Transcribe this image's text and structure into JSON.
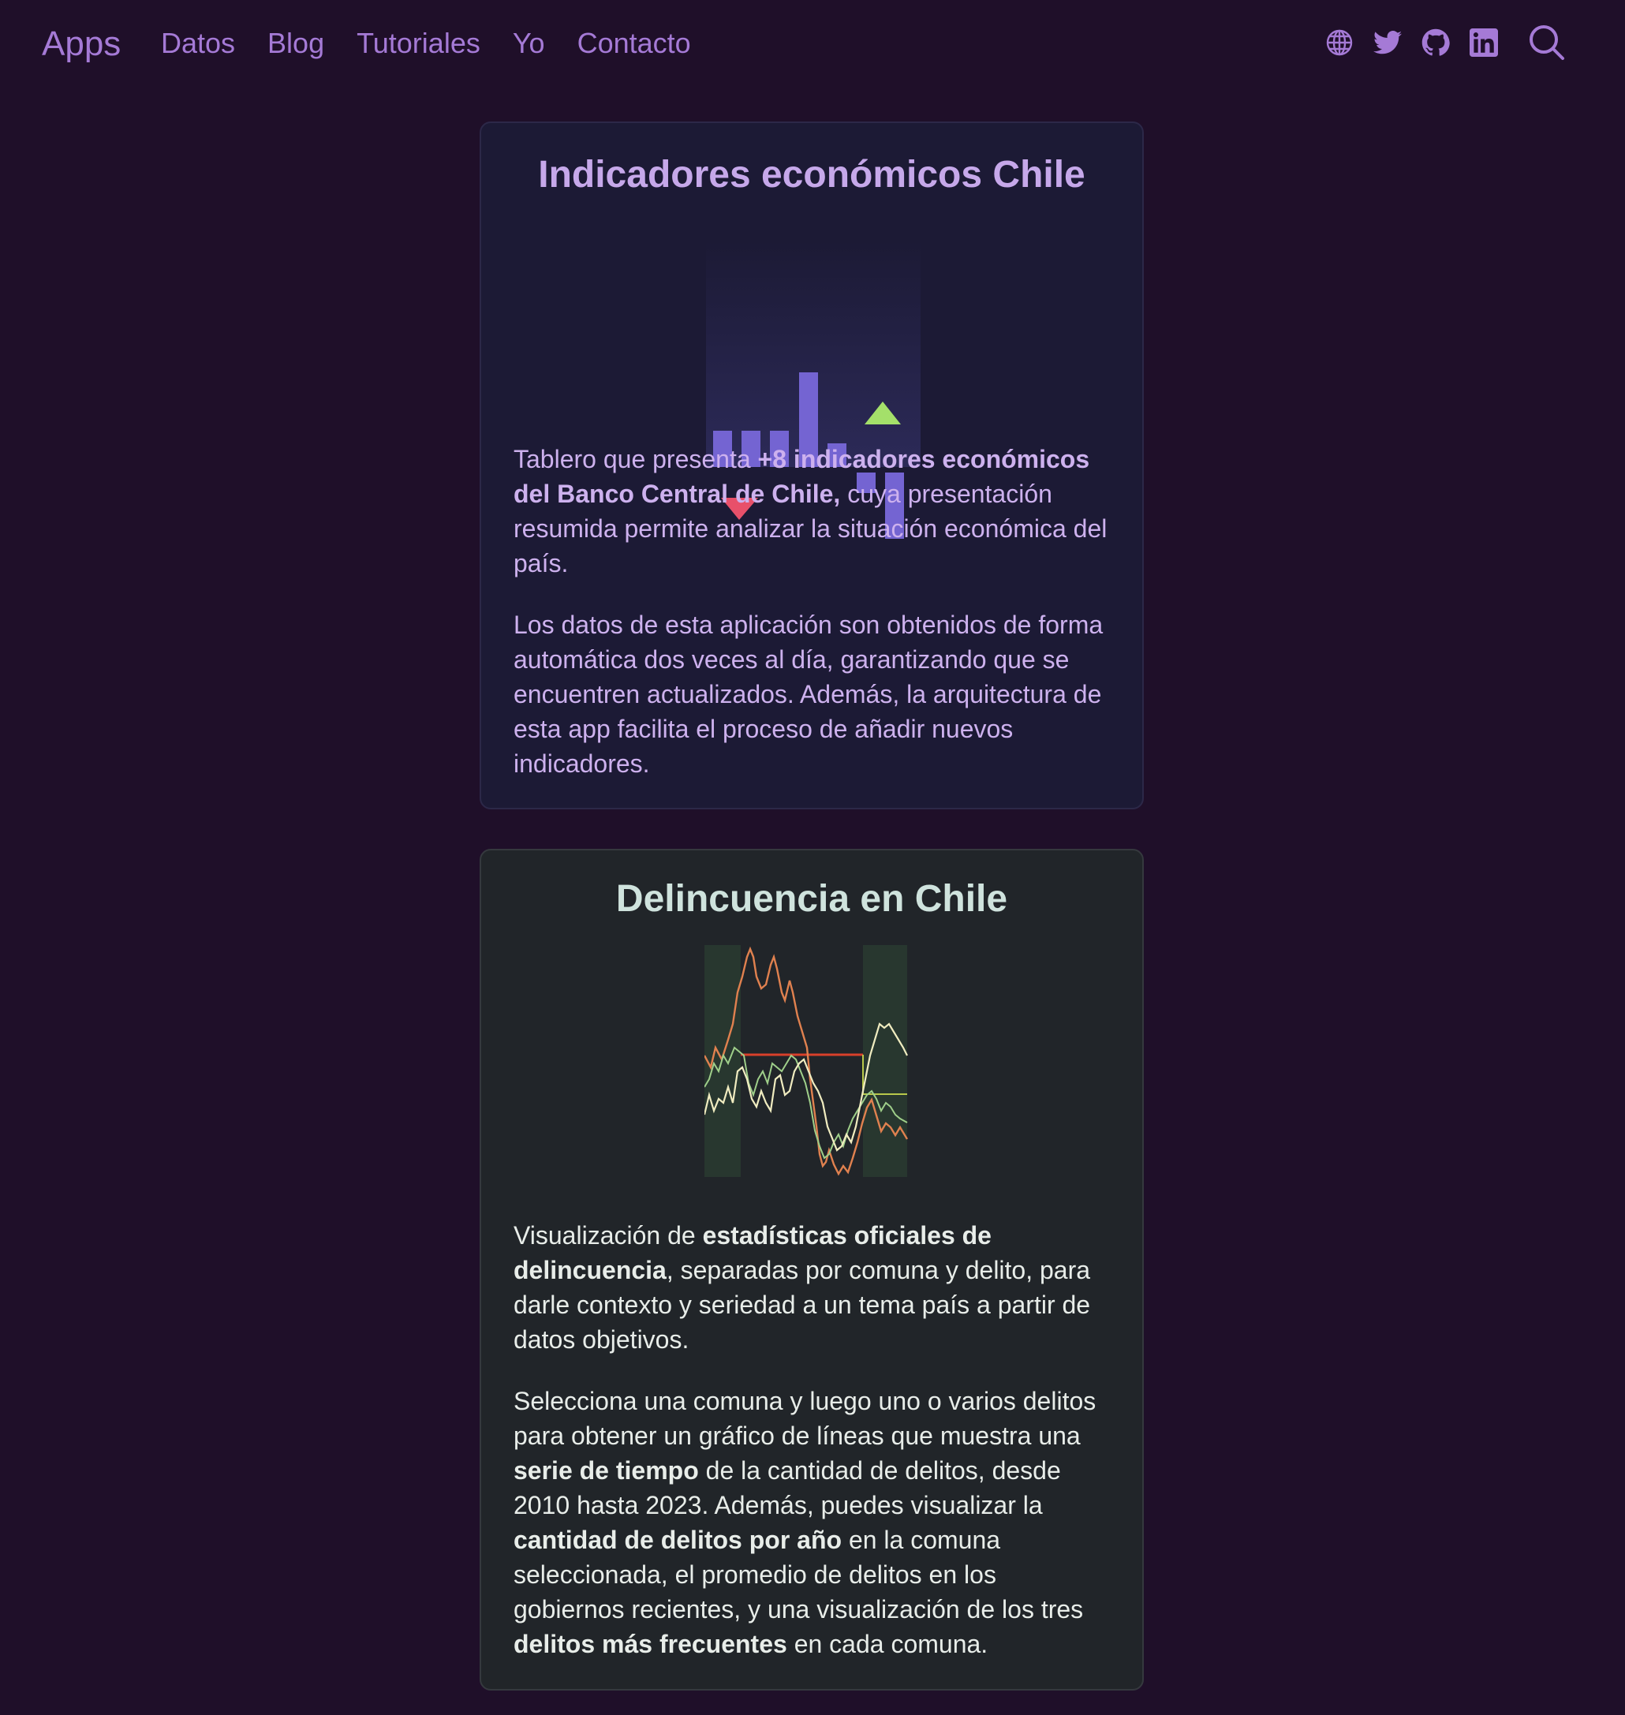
{
  "nav": {
    "brand": "Apps",
    "links": [
      "Datos",
      "Blog",
      "Tutoriales",
      "Yo",
      "Contacto"
    ],
    "icons": [
      "globe-icon",
      "twitter-icon",
      "github-icon",
      "linkedin-icon",
      "search-icon"
    ],
    "accent_color": "#a57ad6"
  },
  "cards": [
    {
      "title": "Indicadores económicos Chile",
      "paragraphs": [
        [
          {
            "t": "Tablero que presenta ",
            "b": false
          },
          {
            "t": "+8 indicadores económicos del Banco Central de Chile,",
            "b": true
          },
          {
            "t": " cuya presentación resumida permite analizar la situación económica del país.",
            "b": false
          }
        ],
        [
          {
            "t": "Los datos de esta aplicación son obtenidos de forma automática dos veces al día, garantizando que se encuentren actualizados. Además, la arquitectura de esta app facilita el proceso de añadir nuevos indicadores.",
            "b": false
          }
        ]
      ]
    },
    {
      "title": "Delincuencia en Chile",
      "paragraphs": [
        [
          {
            "t": "Visualización de ",
            "b": false
          },
          {
            "t": "estadísticas oficiales de delincuencia",
            "b": true
          },
          {
            "t": ", separadas por comuna y delito, para darle contexto y seriedad a un tema país a partir de datos objetivos.",
            "b": false
          }
        ],
        [
          {
            "t": "Selecciona una comuna y luego uno o varios delitos para obtener un gráfico de líneas que muestra una ",
            "b": false
          },
          {
            "t": "serie de tiempo",
            "b": true
          },
          {
            "t": " de la cantidad de delitos, desde 2010 hasta 2023. Además, puedes visualizar la ",
            "b": false
          },
          {
            "t": "cantidad de delitos por año",
            "b": true
          },
          {
            "t": " en la comuna seleccionada, el promedio de delitos en los gobiernos recientes, y una visualización de los tres ",
            "b": false
          },
          {
            "t": "delitos más frecuentes",
            "b": true
          },
          {
            "t": " en cada comuna.",
            "b": false
          }
        ]
      ]
    }
  ],
  "colors": {
    "page_background": "#1f0f29",
    "econ_card_background": "#1c1a35",
    "crime_card_background": "#212529",
    "econ_text": "#cdb1ee",
    "crime_text": "#e8ede9",
    "bar_purple": "#7464d2",
    "arrow_up_green": "#a4e06a",
    "arrow_down_red": "#e8506a",
    "line_orange": "#e0814f",
    "line_cream": "#f0ecc0",
    "line_green": "#9fcf8a",
    "threshold_red": "#d8402a"
  }
}
